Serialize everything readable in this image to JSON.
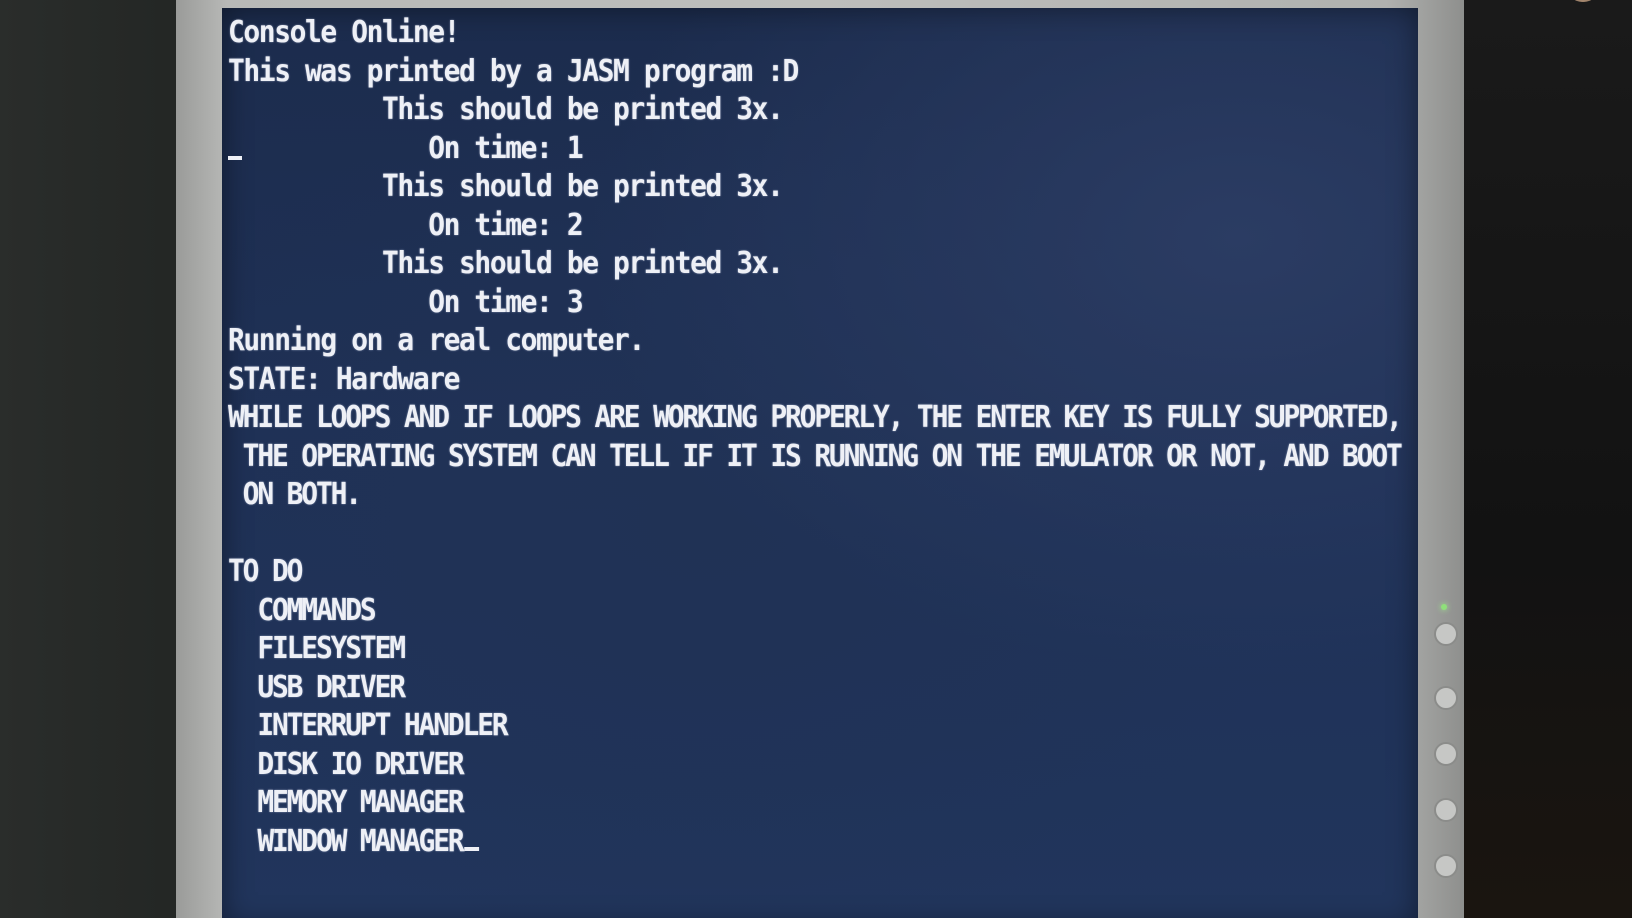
{
  "console": {
    "lines": [
      "Console Online!",
      "This was printed by a JASM program :D",
      "          This should be printed 3x.",
      "             On time: 1",
      "          This should be printed 3x.",
      "             On time: 2",
      "          This should be printed 3x.",
      "             On time: 3",
      "Running on a real computer.",
      "STATE: Hardware",
      "WHILE LOOPS AND IF LOOPS ARE WORKING PROPERLY, THE ENTER KEY IS FULLY SUPPORTED,",
      " THE OPERATING SYSTEM CAN TELL IF IT IS RUNNING ON THE EMULATOR OR NOT, AND BOOT",
      " ON BOTH.",
      "",
      "TO DO",
      "  COMMANDS",
      "  FILESYSTEM",
      "  USB DRIVER",
      "  INTERRUPT HANDLER",
      "  DISK IO DRIVER",
      "  MEMORY MANAGER",
      "  WINDOW MANAGER"
    ]
  },
  "colors": {
    "screen_background": "#1f3157",
    "text": "#eef0f6",
    "bezel": "#bdbebc"
  }
}
